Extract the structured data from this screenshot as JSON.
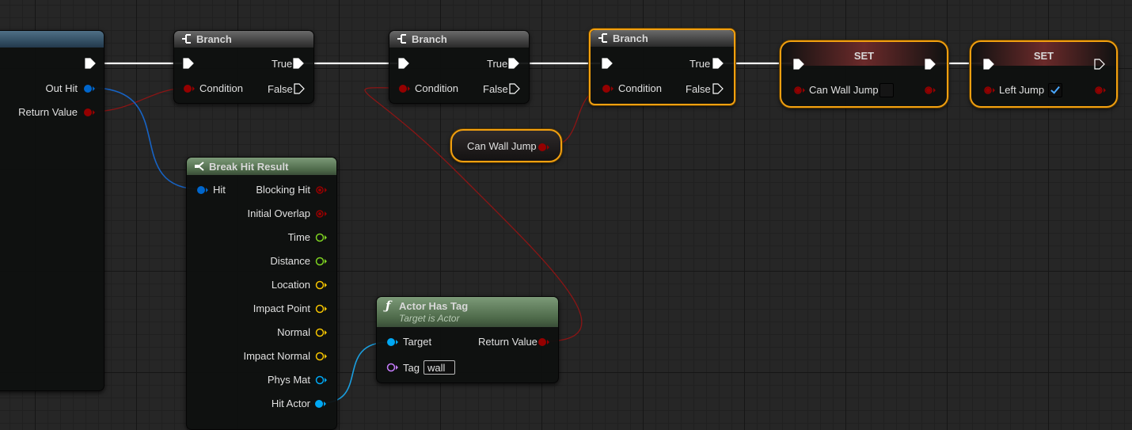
{
  "left_node": {
    "pins": [
      {
        "label": "Out Hit",
        "type": "struct"
      },
      {
        "label": "Return Value",
        "type": "bool"
      }
    ]
  },
  "branch_nodes": [
    {
      "title": "Branch",
      "condition_label": "Condition",
      "true_label": "True",
      "false_label": "False"
    },
    {
      "title": "Branch",
      "condition_label": "Condition",
      "true_label": "True",
      "false_label": "False"
    },
    {
      "title": "Branch",
      "condition_label": "Condition",
      "true_label": "True",
      "false_label": "False"
    }
  ],
  "set_nodes": [
    {
      "title": "SET",
      "variable": "Can Wall Jump",
      "checked": false
    },
    {
      "title": "SET",
      "variable": "Left Jump",
      "checked": true
    }
  ],
  "getter_node": {
    "label": "Can Wall Jump"
  },
  "break_hit_result": {
    "title": "Break Hit Result",
    "input_label": "Hit",
    "outputs": [
      "Blocking Hit",
      "Initial Overlap",
      "Time",
      "Distance",
      "Location",
      "Impact Point",
      "Normal",
      "Impact Normal",
      "Phys Mat",
      "Hit Actor"
    ]
  },
  "actor_has_tag": {
    "title": "Actor Has Tag",
    "subtitle": "Target is Actor",
    "target_label": "Target",
    "tag_label": "Tag",
    "tag_value": "wall",
    "return_label": "Return Value"
  },
  "colors": {
    "exec": "#ffffff",
    "bool": "#950000",
    "struct": "#0066cc",
    "object": "#00a8f4",
    "float": "#7ed321",
    "vector": "#f5c400",
    "name": "#c87dff",
    "selected_outline": "#f2a010",
    "function_header": "#5f7f5c"
  },
  "icons": {
    "branch": "branch-icon",
    "break_struct": "break-struct-icon",
    "function": "function-icon"
  }
}
